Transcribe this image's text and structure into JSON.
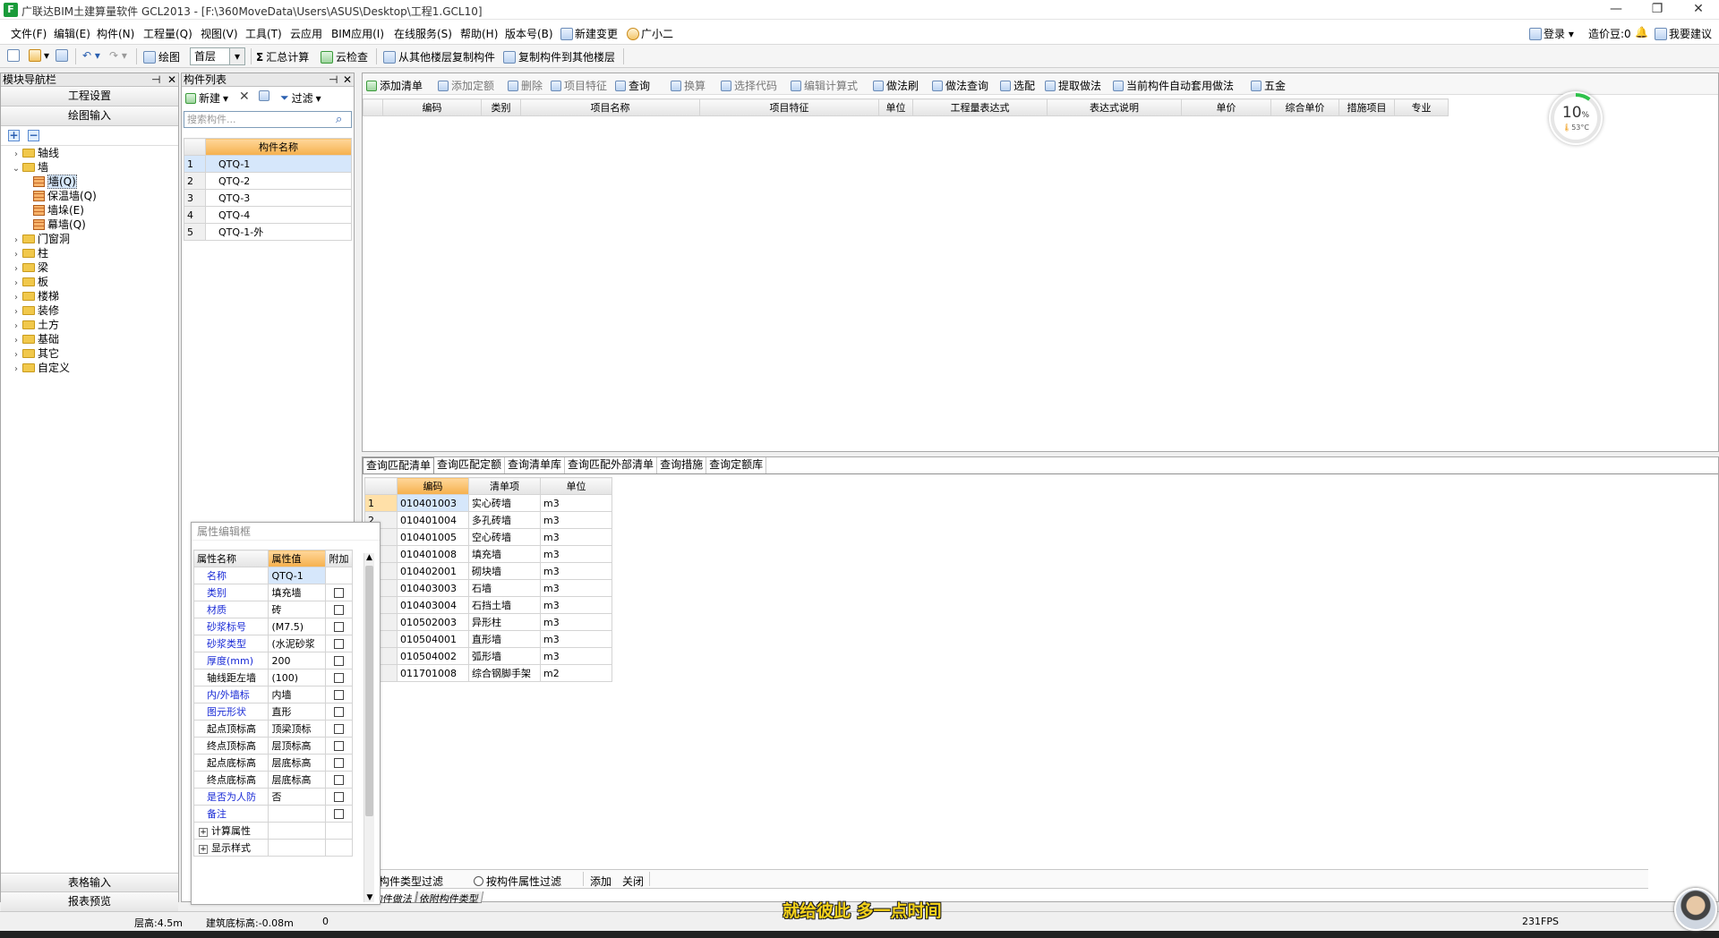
{
  "window": {
    "app_icon": "F",
    "title": "广联达BIM土建算量软件 GCL2013 - [F:\\360MoveData\\Users\\ASUS\\Desktop\\工程1.GCL10]",
    "minimize": "—",
    "restore": "❐",
    "close": "✕"
  },
  "menu": {
    "items": [
      "文件(F)",
      "编辑(E)",
      "构件(N)",
      "工程量(Q)",
      "视图(V)",
      "工具(T)",
      "云应用",
      "BIM应用(I)",
      "在线服务(S)",
      "帮助(H)",
      "版本号(B)",
      "新建变更",
      "广小二"
    ],
    "login": "登录",
    "beans": "造价豆:0",
    "suggest": "我要建议"
  },
  "toolbar1": {
    "draw": "绘图",
    "floor": "首层",
    "sum_calc": "汇总计算",
    "cloud_check": "云检查",
    "copy_from_floor": "从其他楼层复制构件",
    "copy_to_floor": "复制构件到其他楼层"
  },
  "nav": {
    "header": "模块导航栏",
    "project_settings": "工程设置",
    "drawing_input": "绘图输入",
    "tree": [
      {
        "label": "轴线",
        "level": 0,
        "expanded": false
      },
      {
        "label": "墙",
        "level": 0,
        "expanded": true
      },
      {
        "label": "墙(Q)",
        "level": 1,
        "selected": true
      },
      {
        "label": "保温墙(Q)",
        "level": 1
      },
      {
        "label": "墙垛(E)",
        "level": 1
      },
      {
        "label": "幕墙(Q)",
        "level": 1
      },
      {
        "label": "门窗洞",
        "level": 0
      },
      {
        "label": "柱",
        "level": 0
      },
      {
        "label": "梁",
        "level": 0
      },
      {
        "label": "板",
        "level": 0
      },
      {
        "label": "楼梯",
        "level": 0
      },
      {
        "label": "装修",
        "level": 0
      },
      {
        "label": "土方",
        "level": 0
      },
      {
        "label": "基础",
        "level": 0
      },
      {
        "label": "其它",
        "level": 0
      },
      {
        "label": "自定义",
        "level": 0
      }
    ],
    "table_input": "表格输入",
    "report_preview": "报表预览"
  },
  "complist": {
    "header": "构件列表",
    "new": "新建",
    "filter": "过滤",
    "search_placeholder": "搜索构件...",
    "col_name": "构件名称",
    "rows": [
      {
        "n": "1",
        "name": "QTQ-1"
      },
      {
        "n": "2",
        "name": "QTQ-2"
      },
      {
        "n": "3",
        "name": "QTQ-3"
      },
      {
        "n": "4",
        "name": "QTQ-4"
      },
      {
        "n": "5",
        "name": "QTQ-1-外"
      }
    ]
  },
  "main_toolbar": {
    "items": [
      "添加清单",
      "添加定额",
      "删除",
      "项目特征",
      "查询",
      "换算",
      "选择代码",
      "编辑计算式",
      "做法刷",
      "做法查询",
      "选配",
      "提取做法",
      "当前构件自动套用做法",
      "五金"
    ]
  },
  "main_table": {
    "columns": [
      "编码",
      "类别",
      "项目名称",
      "项目特征",
      "单位",
      "工程量表达式",
      "表达式说明",
      "单价",
      "综合单价",
      "措施项目",
      "专业"
    ]
  },
  "lower": {
    "tabs": [
      "查询匹配清单",
      "查询匹配定额",
      "查询清单库",
      "查询匹配外部清单",
      "查询措施",
      "查询定额库"
    ],
    "columns": [
      "编码",
      "清单项",
      "单位"
    ],
    "rows": [
      {
        "n": "1",
        "code": "010401003",
        "item": "实心砖墙",
        "unit": "m3"
      },
      {
        "n": "2",
        "code": "010401004",
        "item": "多孔砖墙",
        "unit": "m3"
      },
      {
        "n": "3",
        "code": "010401005",
        "item": "空心砖墙",
        "unit": "m3"
      },
      {
        "n": "4",
        "code": "010401008",
        "item": "填充墙",
        "unit": "m3"
      },
      {
        "n": "5",
        "code": "010402001",
        "item": "砌块墙",
        "unit": "m3"
      },
      {
        "n": "6",
        "code": "010403003",
        "item": "石墙",
        "unit": "m3"
      },
      {
        "n": "7",
        "code": "010403004",
        "item": "石挡土墙",
        "unit": "m3"
      },
      {
        "n": "8",
        "code": "010502003",
        "item": "异形柱",
        "unit": "m3"
      },
      {
        "n": "9",
        "code": "010504001",
        "item": "直形墙",
        "unit": "m3"
      },
      {
        "n": "10",
        "code": "010504002",
        "item": "弧形墙",
        "unit": "m3"
      },
      {
        "n": "11",
        "code": "011701008",
        "item": "综合钢脚手架",
        "unit": "m2"
      }
    ],
    "filter_type": "按构件类型过滤",
    "filter_attr": "按构件属性过滤",
    "add": "添加",
    "close": "关闭",
    "bottom_tabs": [
      "构件做法",
      "依附构件类型"
    ]
  },
  "props": {
    "header": "属性编辑框",
    "col_name": "属性名称",
    "col_value": "属性值",
    "col_extra": "附加",
    "rows": [
      {
        "name": "名称",
        "value": "QTQ-1",
        "blue": true,
        "chk": false
      },
      {
        "name": "类别",
        "value": "填充墙",
        "blue": true,
        "chk": true
      },
      {
        "name": "材质",
        "value": "砖",
        "blue": true,
        "chk": true
      },
      {
        "name": "砂浆标号",
        "value": "(M7.5)",
        "blue": true,
        "chk": true
      },
      {
        "name": "砂浆类型",
        "value": "(水泥砂浆",
        "blue": true,
        "chk": true
      },
      {
        "name": "厚度(mm)",
        "value": "200",
        "blue": true,
        "chk": true
      },
      {
        "name": "轴线距左墙",
        "value": "(100)",
        "blue": false,
        "chk": true
      },
      {
        "name": "内/外墙标",
        "value": "内墙",
        "blue": true,
        "chk": true
      },
      {
        "name": "图元形状",
        "value": "直形",
        "blue": true,
        "chk": true
      },
      {
        "name": "起点顶标高",
        "value": "顶梁顶标",
        "blue": false,
        "chk": true
      },
      {
        "name": "终点顶标高",
        "value": "层顶标高",
        "blue": false,
        "chk": true
      },
      {
        "name": "起点底标高",
        "value": "层底标高",
        "blue": false,
        "chk": true
      },
      {
        "name": "终点底标高",
        "value": "层底标高",
        "blue": false,
        "chk": true
      },
      {
        "name": "是否为人防",
        "value": "否",
        "blue": true,
        "chk": true
      },
      {
        "name": "备注",
        "value": "",
        "blue": true,
        "chk": true
      },
      {
        "name": "计算属性",
        "value": "",
        "blue": false,
        "chk": false,
        "group": true
      },
      {
        "name": "显示样式",
        "value": "",
        "blue": false,
        "chk": false,
        "group": true
      }
    ]
  },
  "gauge": {
    "value": "10",
    "unit": "%",
    "temp": "53°C",
    "percent": 10
  },
  "status": {
    "floor_height": "层高:4.5m",
    "base_elev": "建筑底标高:-0.08m",
    "zero": "0",
    "fps": "231FPS"
  },
  "subtitle": "就给彼此 多一点时间",
  "colors": {
    "accent": "#f5b04c",
    "selection": "#d6e7fb",
    "subtitle": "#f5d21a",
    "gauge": "#2ec24a"
  }
}
